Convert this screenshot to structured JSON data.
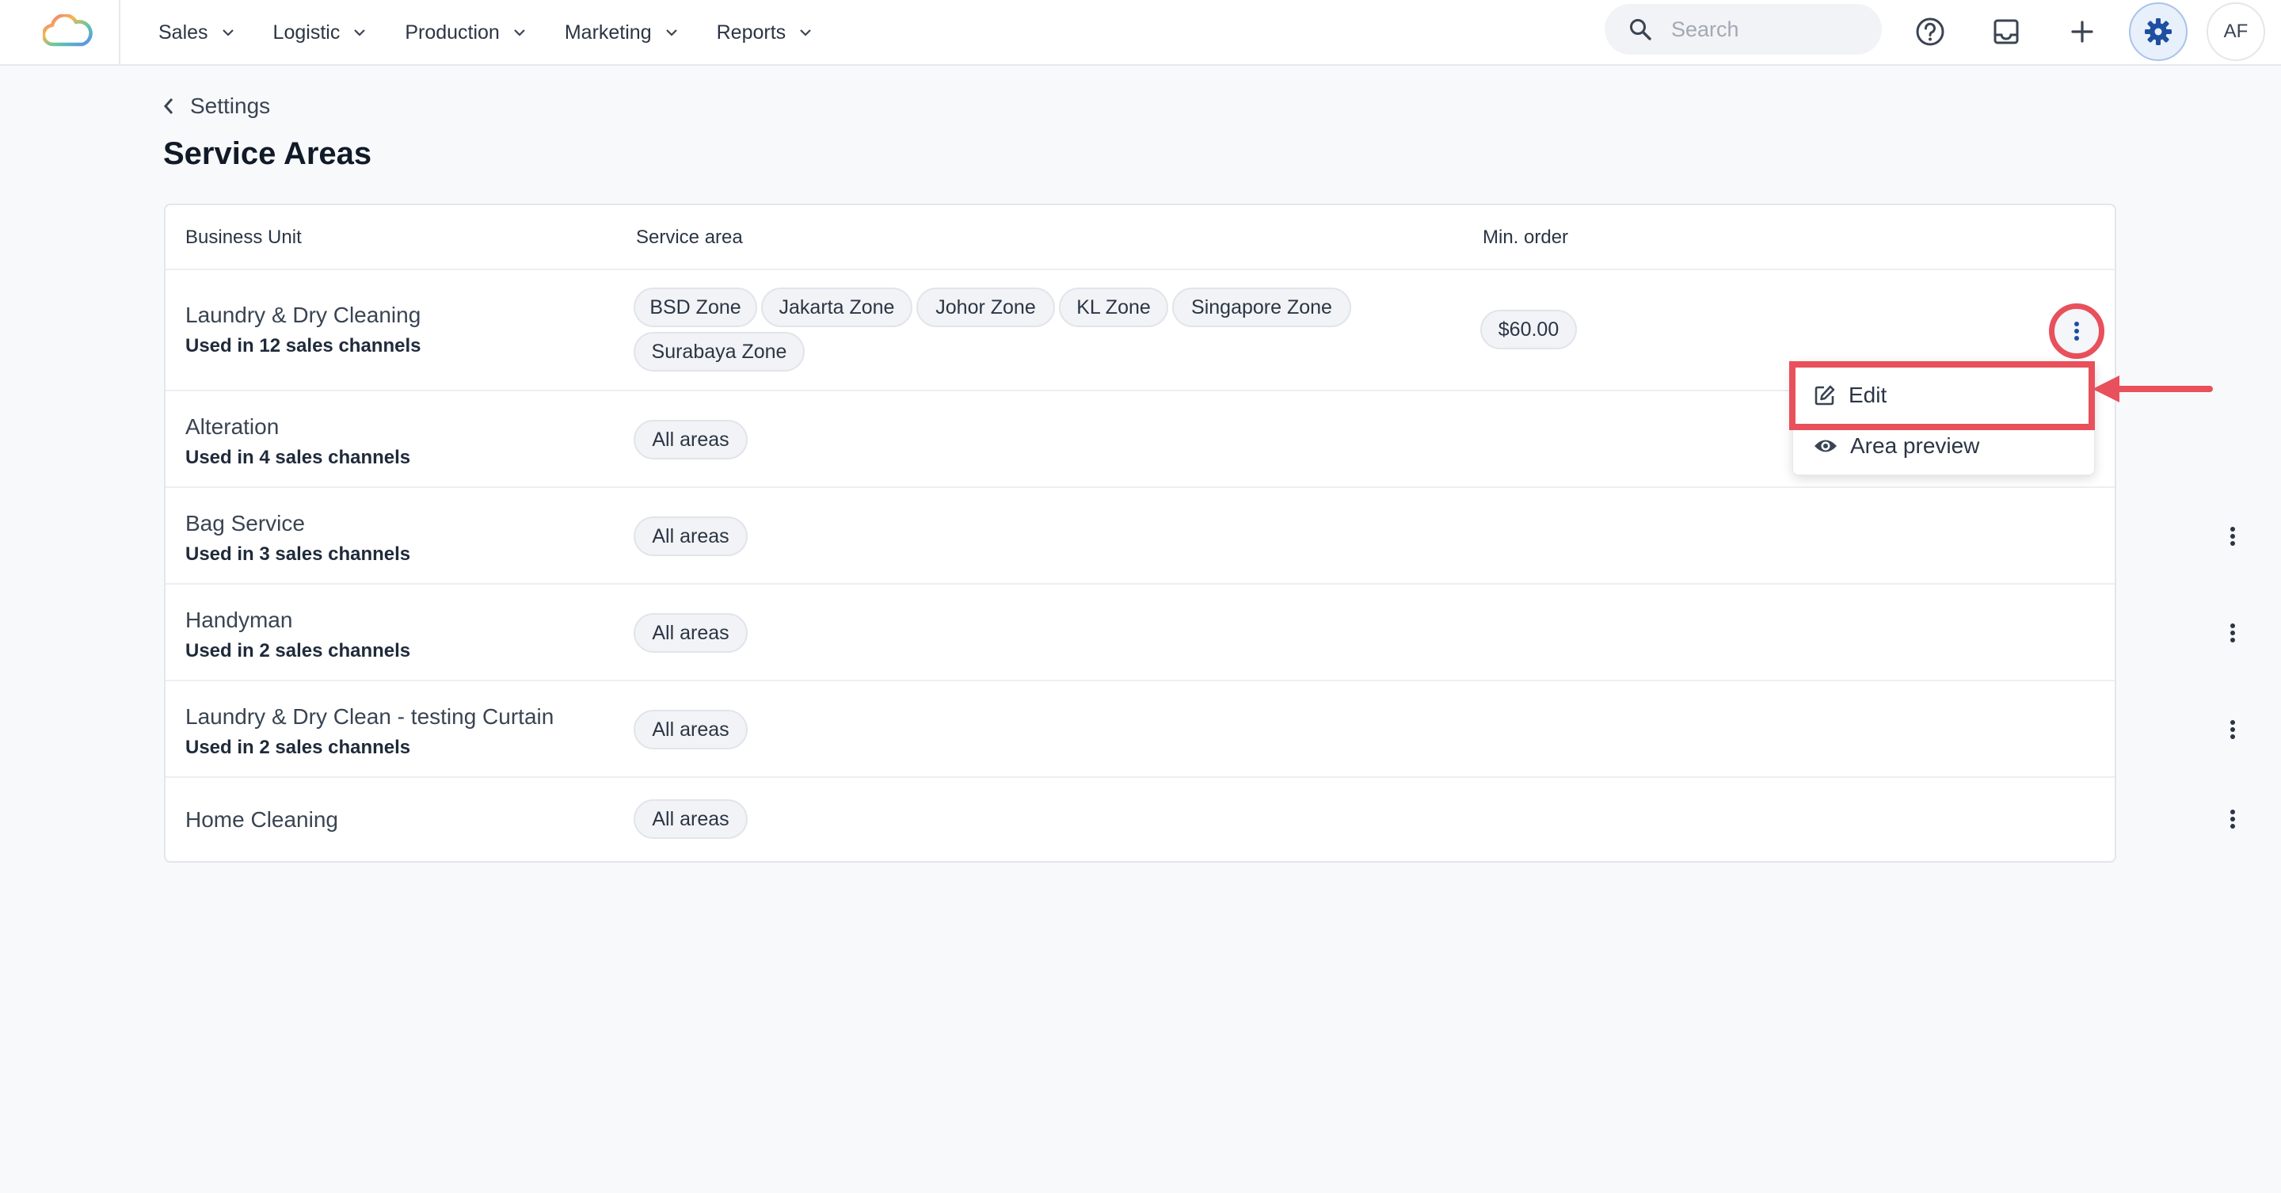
{
  "nav": {
    "items": [
      {
        "label": "Sales"
      },
      {
        "label": "Logistic"
      },
      {
        "label": "Production"
      },
      {
        "label": "Marketing"
      },
      {
        "label": "Reports"
      }
    ],
    "search_placeholder": "Search",
    "avatar_initials": "AF"
  },
  "page": {
    "back_label": "Settings",
    "title": "Service Areas"
  },
  "table": {
    "headers": {
      "business_unit": "Business Unit",
      "service_area": "Service area",
      "min_order": "Min. order"
    },
    "rows": [
      {
        "name": "Laundry & Dry Cleaning",
        "sub": "Used in 12 sales channels",
        "areas": [
          "BSD Zone",
          "Jakarta Zone",
          "Johor Zone",
          "KL Zone",
          "Singapore Zone",
          "Surabaya Zone"
        ],
        "min_order": "$60.00"
      },
      {
        "name": "Alteration",
        "sub": "Used in 4 sales channels",
        "areas": [
          "All areas"
        ]
      },
      {
        "name": "Bag Service",
        "sub": "Used in 3 sales channels",
        "areas": [
          "All areas"
        ]
      },
      {
        "name": "Handyman",
        "sub": "Used in 2 sales channels",
        "areas": [
          "All areas"
        ]
      },
      {
        "name": "Laundry & Dry Clean - testing Curtain",
        "sub": "Used in 2 sales channels",
        "areas": [
          "All areas"
        ]
      },
      {
        "name": "Home Cleaning",
        "areas": [
          "All areas"
        ]
      }
    ]
  },
  "menu": {
    "edit_label": "Edit",
    "preview_label": "Area preview"
  },
  "colors": {
    "highlight": "#e8505b",
    "accent": "#1e4fa0"
  }
}
